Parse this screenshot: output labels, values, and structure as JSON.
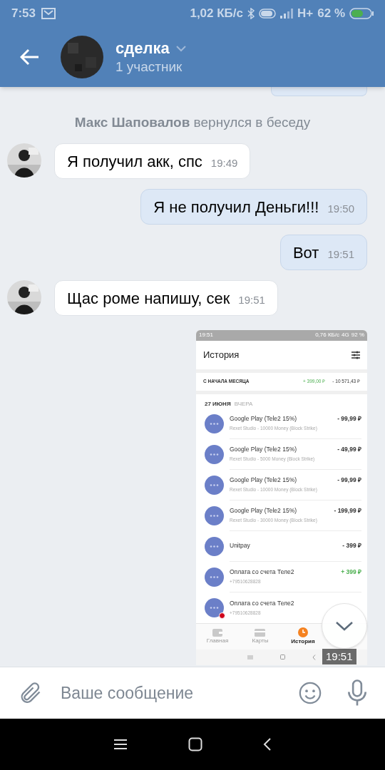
{
  "status_bar": {
    "time": "7:53",
    "speed": "1,02 КБ/с",
    "network": "H+",
    "battery": "62 %"
  },
  "header": {
    "title": "сделка",
    "subtitle": "1 участник"
  },
  "messages": [
    {
      "kind": "clipped"
    },
    {
      "kind": "system",
      "text": "**Макс Шаповалов** вернулся в беседу"
    },
    {
      "kind": "incoming",
      "text": "Я получил акк, спс",
      "time": "19:49"
    },
    {
      "kind": "outgoing",
      "text": "Я не получил Деньги!!!",
      "time": "19:50"
    },
    {
      "kind": "outgoing",
      "text": "Вот",
      "time": "19:51"
    },
    {
      "kind": "incoming",
      "text": "Щас роме напишу, сек",
      "time": "19:51"
    },
    {
      "time": "19:51"
    }
  ],
  "shared_screenshot": {
    "status_bar": {
      "time": "19:51",
      "speed": "0,76 КБ/с",
      "network": "4G",
      "battery": "92 %"
    },
    "title": "История",
    "summary": {
      "label": "С НАЧАЛА МЕСЯЦА",
      "income": "+ 399,00 ₽",
      "expense": "- 10 571,43 ₽"
    },
    "date": "27 ИЮНЯ",
    "day_label": "ВЧЕРА",
    "transactions": [
      {
        "title": "Google Play (Tele2 15%)",
        "subtitle": "Rexet Studio - 10000 Money  (Block Strike)",
        "amount": "- 99,99 ₽",
        "positive": false,
        "alert": false
      },
      {
        "title": "Google Play (Tele2 15%)",
        "subtitle": "Rexet Studio - 5000 Money (Block Strike)",
        "amount": "- 49,99 ₽",
        "positive": false,
        "alert": false
      },
      {
        "title": "Google Play (Tele2 15%)",
        "subtitle": "Rexet Studio - 10000 Money  (Block Strike)",
        "amount": "- 99,99 ₽",
        "positive": false,
        "alert": false
      },
      {
        "title": "Google Play (Tele2 15%)",
        "subtitle": "Rexet Studio - 30000 Money (Block Strike)",
        "amount": "- 199,99 ₽",
        "positive": false,
        "alert": false
      },
      {
        "title": "Unitpay",
        "amount": "- 399 ₽",
        "positive": false,
        "alert": false
      },
      {
        "title": "Оплата со счета Теле2",
        "subtitle": "+79510628828",
        "amount": "+ 399 ₽",
        "positive": true,
        "alert": false
      },
      {
        "title": "Оплата со счета Теле2",
        "subtitle": "+79510628828",
        "alert": true
      }
    ],
    "tabs": [
      {
        "label": "Главная",
        "selected": false
      },
      {
        "label": "Карты",
        "selected": false
      },
      {
        "label": "История",
        "selected": true
      }
    ]
  },
  "composer": {
    "placeholder": "Ваше сообщение"
  }
}
